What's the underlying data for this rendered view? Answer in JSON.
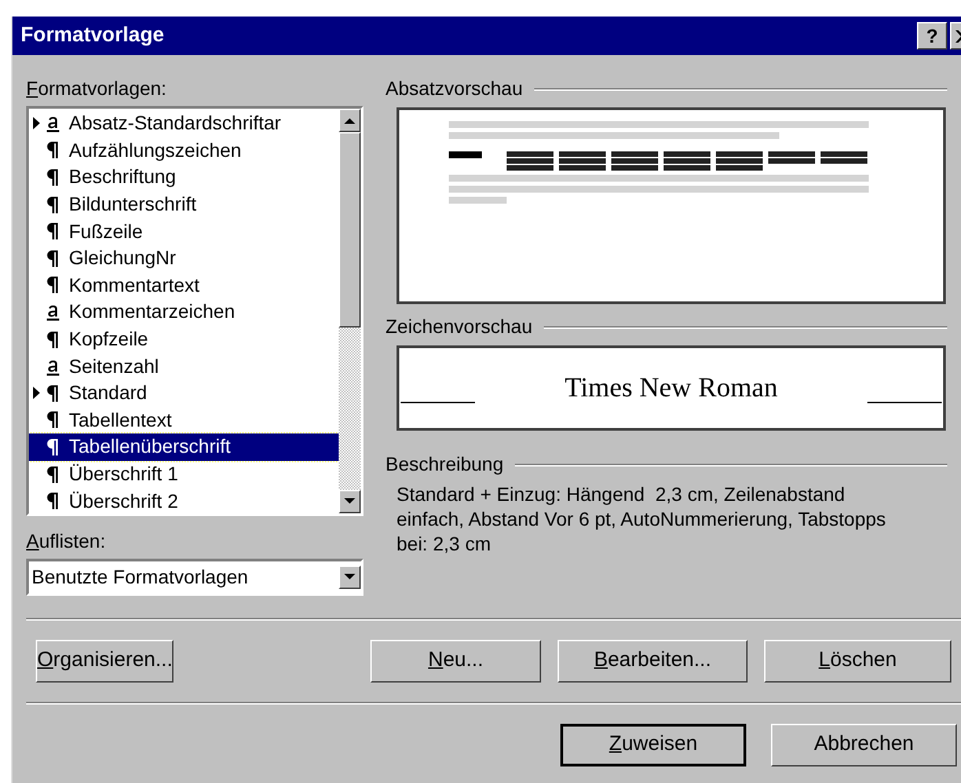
{
  "window": {
    "title": "Formatvorlage",
    "help_button": "?"
  },
  "styles": {
    "label": "Formatvorlagen:",
    "mnemonic": true,
    "items": [
      {
        "name": "Absatz-Standardschriftar",
        "kind": "character",
        "expandable": true,
        "selected": false
      },
      {
        "name": "Aufzählungszeichen",
        "kind": "paragraph",
        "expandable": false,
        "selected": false
      },
      {
        "name": "Beschriftung",
        "kind": "paragraph",
        "expandable": false,
        "selected": false
      },
      {
        "name": "Bildunterschrift",
        "kind": "paragraph",
        "expandable": false,
        "selected": false
      },
      {
        "name": "Fußzeile",
        "kind": "paragraph",
        "expandable": false,
        "selected": false
      },
      {
        "name": "GleichungNr",
        "kind": "paragraph",
        "expandable": false,
        "selected": false
      },
      {
        "name": "Kommentartext",
        "kind": "paragraph",
        "expandable": false,
        "selected": false
      },
      {
        "name": "Kommentarzeichen",
        "kind": "character",
        "expandable": false,
        "selected": false
      },
      {
        "name": "Kopfzeile",
        "kind": "paragraph",
        "expandable": false,
        "selected": false
      },
      {
        "name": "Seitenzahl",
        "kind": "character",
        "expandable": false,
        "selected": false
      },
      {
        "name": "Standard",
        "kind": "paragraph",
        "expandable": true,
        "selected": false
      },
      {
        "name": "Tabellentext",
        "kind": "paragraph",
        "expandable": false,
        "selected": false
      },
      {
        "name": "Tabellenüberschrift",
        "kind": "paragraph",
        "expandable": false,
        "selected": true
      },
      {
        "name": "Überschrift 1",
        "kind": "paragraph",
        "expandable": false,
        "selected": false
      },
      {
        "name": "Überschrift 2",
        "kind": "paragraph",
        "expandable": false,
        "selected": false
      }
    ]
  },
  "list_filter": {
    "label": "Auflisten:",
    "mnemonic": true,
    "value": "Benutzte Formatvorlagen"
  },
  "paragraph_preview": {
    "label": "Absatzvorschau"
  },
  "character_preview": {
    "label": "Zeichenvorschau",
    "sample": "Times New Roman"
  },
  "description": {
    "label": "Beschreibung",
    "text": "Standard + Einzug: Hängend  2,3 cm, Zeilenabstand einfach, Abstand Vor 6 pt, AutoNummerierung, Tabstopps bei: 2,3 cm"
  },
  "actions": [
    {
      "label": "Organisieren...",
      "mnemonic": true
    },
    {
      "label": "Neu...",
      "mnemonic": true
    },
    {
      "label": "Bearbeiten...",
      "mnemonic": true
    },
    {
      "label": "Löschen",
      "mnemonic": true
    }
  ],
  "footer_buttons": [
    {
      "label": "Zuweisen",
      "mnemonic": true,
      "default": true
    },
    {
      "label": "Abbrechen",
      "mnemonic": false,
      "default": false
    }
  ]
}
